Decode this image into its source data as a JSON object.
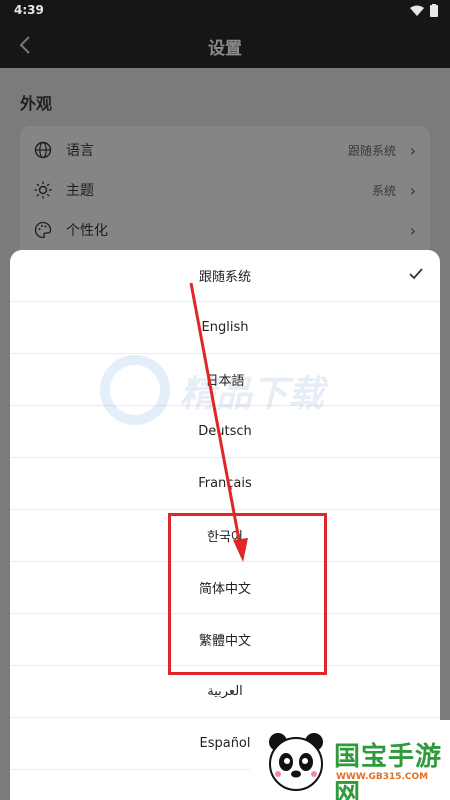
{
  "status": {
    "time": "4:39"
  },
  "appbar": {
    "title": "设置"
  },
  "section": {
    "title": "外观"
  },
  "settings": [
    {
      "label": "语言",
      "value": "跟随系统",
      "icon": "globe-icon"
    },
    {
      "label": "主题",
      "value": "系统",
      "icon": "sun-icon"
    },
    {
      "label": "个性化",
      "value": "",
      "icon": "palette-icon"
    }
  ],
  "languages": [
    {
      "label": "跟随系统",
      "selected": true
    },
    {
      "label": "English"
    },
    {
      "label": "日本語"
    },
    {
      "label": "Deutsch"
    },
    {
      "label": "Français"
    },
    {
      "label": "한국어"
    },
    {
      "label": "简体中文"
    },
    {
      "label": "繁體中文"
    },
    {
      "label": "العربية"
    },
    {
      "label": "Español"
    }
  ],
  "watermark": {
    "text": "精品下载"
  },
  "brand": {
    "name": "国宝手游网",
    "url": "WWW.GB315.COM"
  },
  "colors": {
    "highlight": "#e02626",
    "sheet": "#ffffff"
  }
}
